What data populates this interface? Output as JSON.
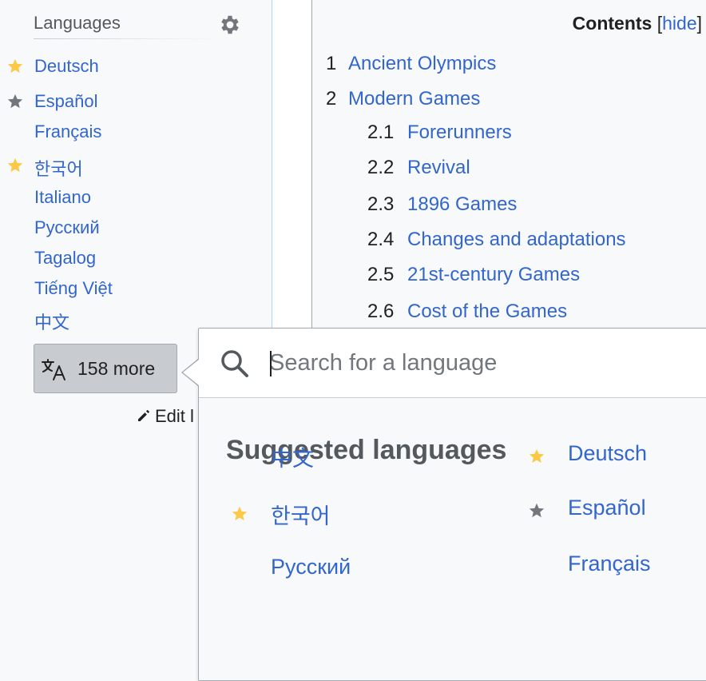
{
  "sidebar": {
    "heading": "Languages",
    "items": [
      {
        "label": "Deutsch",
        "star": "gold"
      },
      {
        "label": "Español",
        "star": "grey"
      },
      {
        "label": "Français",
        "star": ""
      },
      {
        "label": "한국어",
        "star": "gold"
      },
      {
        "label": "Italiano",
        "star": ""
      },
      {
        "label": "Русский",
        "star": ""
      },
      {
        "label": "Tagalog",
        "star": ""
      },
      {
        "label": "Tiếng Việt",
        "star": ""
      },
      {
        "label": "中文",
        "star": ""
      }
    ],
    "more_button": "158 more",
    "edit_links": "Edit l"
  },
  "toc": {
    "title": "Contents",
    "open_bracket": "[",
    "toggle": "hide",
    "close_bracket": "]",
    "items": [
      {
        "num": "1",
        "label": "Ancient Olympics"
      },
      {
        "num": "2",
        "label": "Modern Games"
      },
      {
        "num": "2.1",
        "label": "Forerunners"
      },
      {
        "num": "2.2",
        "label": "Revival"
      },
      {
        "num": "2.3",
        "label": "1896 Games"
      },
      {
        "num": "2.4",
        "label": "Changes and adaptations"
      },
      {
        "num": "2.5",
        "label": "21st-century Games"
      },
      {
        "num": "2.6",
        "label": "Cost of the Games"
      }
    ]
  },
  "popup": {
    "search_placeholder": "Search for a language",
    "search_value": "",
    "suggested_title": "Suggested languages",
    "suggested": [
      {
        "label": "中文",
        "star": ""
      },
      {
        "label": "Deutsch",
        "star": "gold"
      },
      {
        "label": "한국어",
        "star": "gold"
      },
      {
        "label": "Español",
        "star": "grey"
      },
      {
        "label": "Русский",
        "star": ""
      },
      {
        "label": "Français",
        "star": ""
      }
    ]
  },
  "colors": {
    "link": "#3366cc",
    "star_gold": "#fcc847",
    "star_grey": "#72777d",
    "sidebar_bg": "#f8f9fa",
    "button_bg": "#c8ccd1"
  },
  "icons": {
    "settings": "gear-icon",
    "translate": "translate-icon",
    "edit": "pencil-icon",
    "search": "search-icon",
    "star": "star-icon"
  }
}
